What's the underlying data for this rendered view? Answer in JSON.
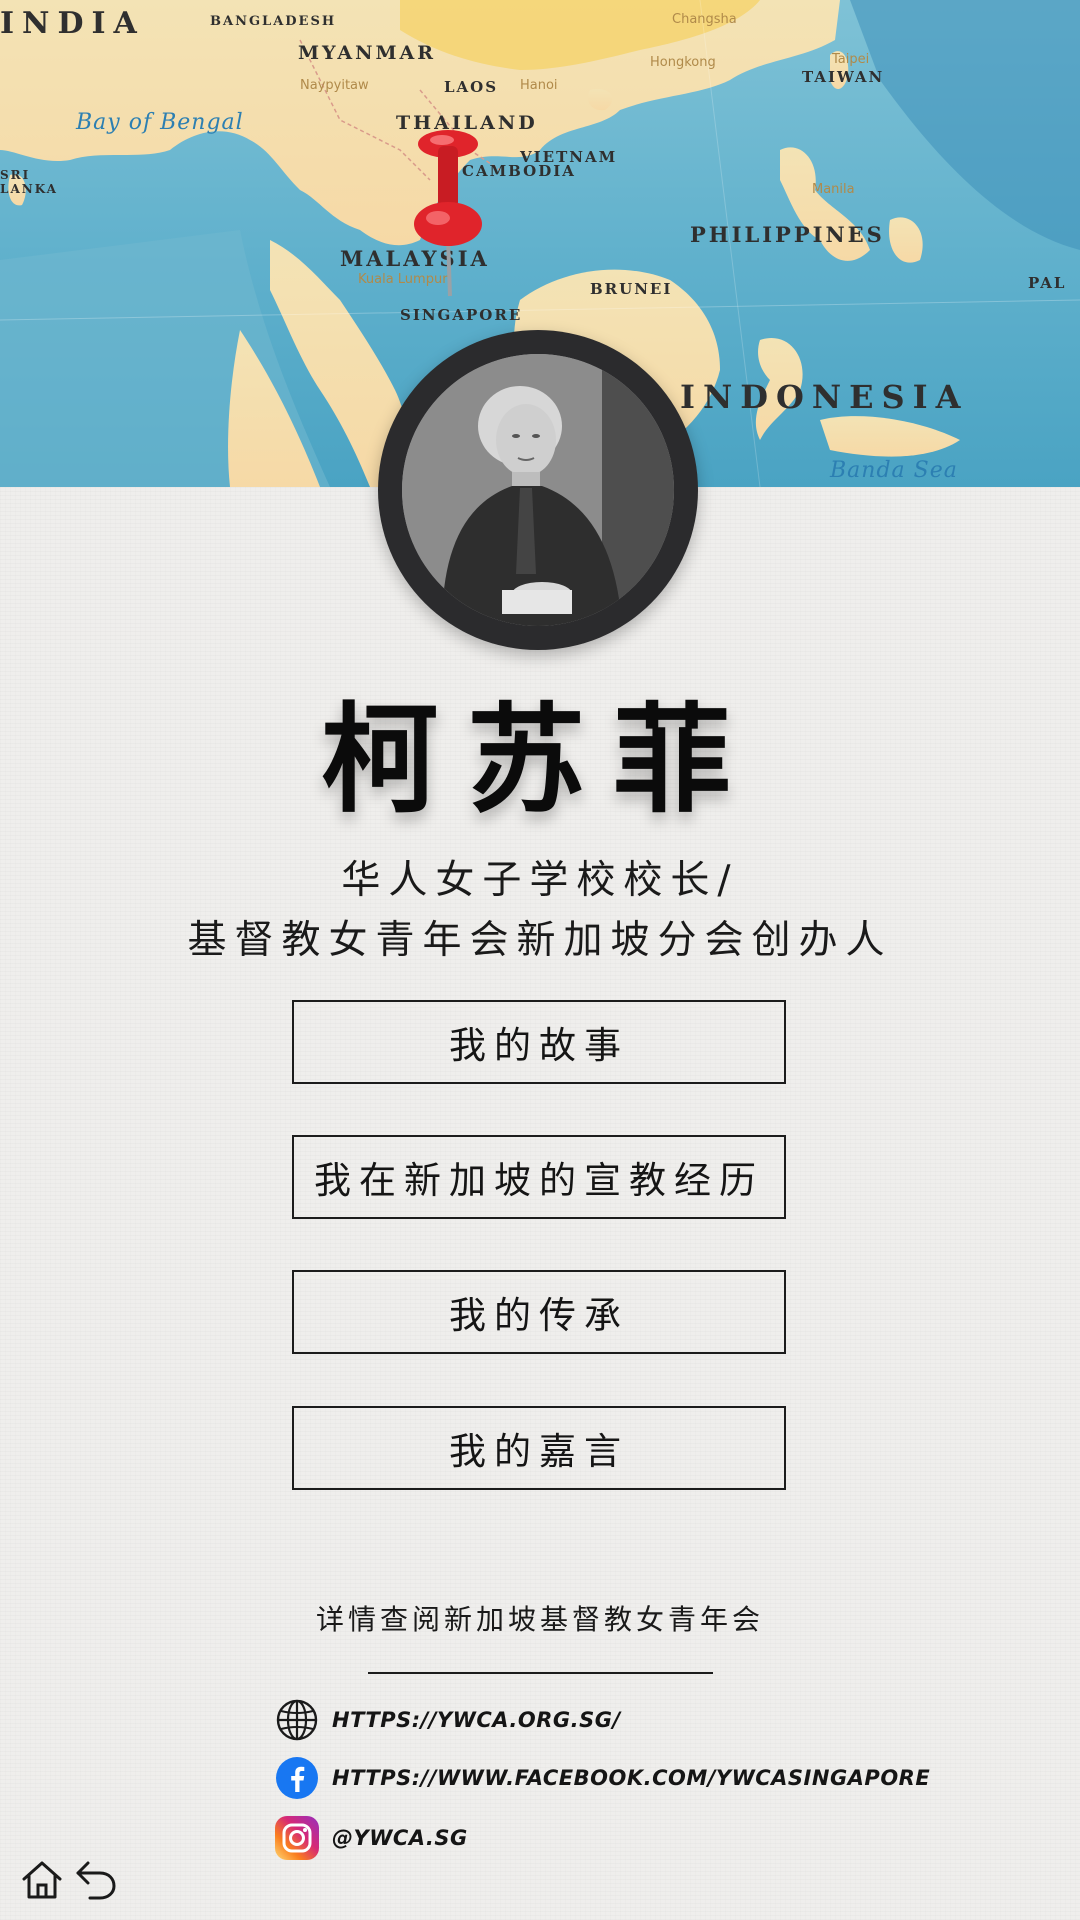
{
  "map": {
    "labels": {
      "india": "INDIA",
      "bangladesh": "BANGLADESH",
      "myanmar": "MYANMAR",
      "laos": "LAOS",
      "thailand": "THAILAND",
      "vietnam": "VIETNAM",
      "cambodia": "CAMBODIA",
      "taiwan": "TAIWAN",
      "philippines": "PHILIPPINES",
      "malaysia": "MALAYSIA",
      "brunei": "BRUNEI",
      "singapore": "SINGAPORE",
      "indonesia": "INDONESIA",
      "sri_lanka": "SRI LANKA",
      "bay_of_bengal": "Bay of Bengal",
      "banda_sea": "Banda Sea",
      "changsha": "Changsha",
      "hongkong": "Hongkong",
      "taipei": "Taipei",
      "manila": "Manila",
      "naypyitaw": "Naypyitaw",
      "hanoi": "Hanoi",
      "kuala_lumpur": "Kuala Lumpur",
      "pal": "PAL"
    },
    "pin_color": "#e0242b",
    "pin_icon": "map-pin-icon"
  },
  "profile": {
    "name": "柯苏菲",
    "title_line1": "华人女子学校校长/",
    "title_line2": "基督教女青年会新加坡分会创办人"
  },
  "menu": [
    {
      "label": "我的故事"
    },
    {
      "label": "我在新加坡的宣教经历"
    },
    {
      "label": "我的传承"
    },
    {
      "label": "我的嘉言"
    }
  ],
  "footer": {
    "note": "详情查阅新加坡基督教女青年会",
    "links": [
      {
        "icon": "globe-icon",
        "text": "HTTPS://YWCA.ORG.SG/"
      },
      {
        "icon": "facebook-icon",
        "text": "HTTPS://WWW.FACEBOOK.COM/YWCASINGAPORE"
      },
      {
        "icon": "instagram-icon",
        "text": "@YWCA.SG"
      }
    ]
  },
  "nav": {
    "home_icon": "home-icon",
    "back_icon": "back-arrow-icon"
  },
  "colors": {
    "background": "#efeeec",
    "text": "#111111",
    "facebook": "#1877f2",
    "pin": "#e0242b"
  }
}
